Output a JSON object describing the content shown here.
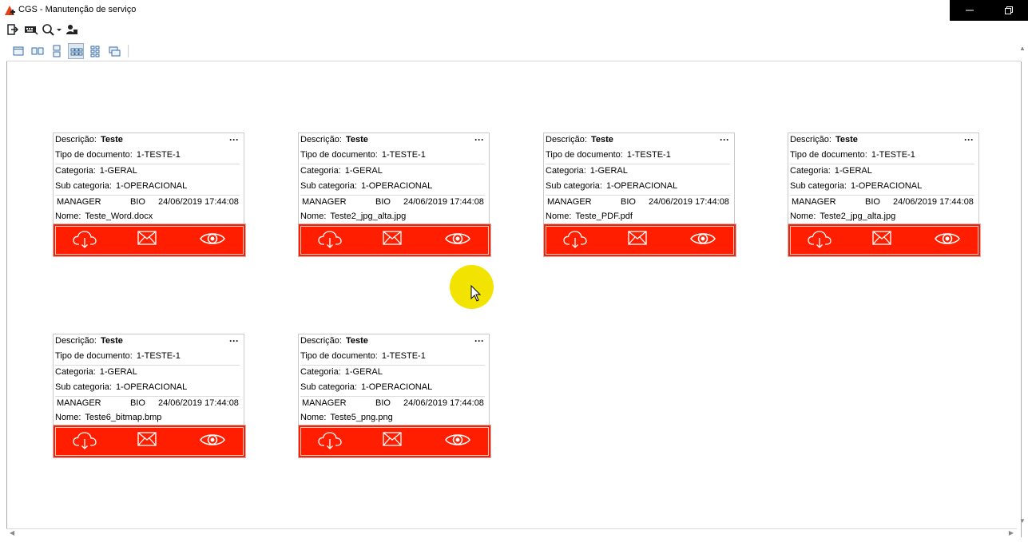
{
  "window": {
    "title": "CGS - Manutenção de serviço",
    "controls": [
      "minimize-icon",
      "restore-icon"
    ]
  },
  "toolbar": {
    "actions": [
      "exit-icon",
      "keyboard-icon",
      "search-dropdown-icon",
      "user-icon"
    ]
  },
  "view_modes": {
    "items": [
      "single-view-icon",
      "two-columns-view-icon",
      "two-rows-view-icon",
      "grid-view-icon",
      "tile-view-icon",
      "card-view-icon"
    ],
    "selected": "grid-view-icon"
  },
  "labels": {
    "descricao": "Descrição:",
    "tipo": "Tipo de documento:",
    "categoria": "Categoria:",
    "subcategoria": "Sub categoria:",
    "nome": "Nome:",
    "more": "···"
  },
  "cards": [
    {
      "descricao": "Teste",
      "tipo": "1-TESTE-1",
      "categoria": "1-GERAL",
      "subcategoria": "1-OPERACIONAL",
      "usuario": "MANAGER",
      "perfil": "BIO",
      "data": "24/06/2019 17:44:08",
      "nome": "Teste_Word.docx"
    },
    {
      "descricao": "Teste",
      "tipo": "1-TESTE-1",
      "categoria": "1-GERAL",
      "subcategoria": "1-OPERACIONAL",
      "usuario": "MANAGER",
      "perfil": "BIO",
      "data": "24/06/2019 17:44:08",
      "nome": "Teste2_jpg_alta.jpg"
    },
    {
      "descricao": "Teste",
      "tipo": "1-TESTE-1",
      "categoria": "1-GERAL",
      "subcategoria": "1-OPERACIONAL",
      "usuario": "MANAGER",
      "perfil": "BIO",
      "data": "24/06/2019 17:44:08",
      "nome": "Teste_PDF.pdf"
    },
    {
      "descricao": "Teste",
      "tipo": "1-TESTE-1",
      "categoria": "1-GERAL",
      "subcategoria": "1-OPERACIONAL",
      "usuario": "MANAGER",
      "perfil": "BIO",
      "data": "24/06/2019 17:44:08",
      "nome": "Teste2_jpg_alta.jpg"
    },
    {
      "descricao": "Teste",
      "tipo": "1-TESTE-1",
      "categoria": "1-GERAL",
      "subcategoria": "1-OPERACIONAL",
      "usuario": "MANAGER",
      "perfil": "BIO",
      "data": "24/06/2019 17:44:08",
      "nome": "Teste6_bitmap.bmp"
    },
    {
      "descricao": "Teste",
      "tipo": "1-TESTE-1",
      "categoria": "1-GERAL",
      "subcategoria": "1-OPERACIONAL",
      "usuario": "MANAGER",
      "perfil": "BIO",
      "data": "24/06/2019 17:44:08",
      "nome": "Teste5_png.png"
    }
  ],
  "card_actions": [
    "cloud-download-icon",
    "email-icon",
    "eye-icon"
  ],
  "colors": {
    "action_bar": "#ff1e00",
    "cursor_highlight": "#f2e400",
    "window_controls": "#000000"
  }
}
